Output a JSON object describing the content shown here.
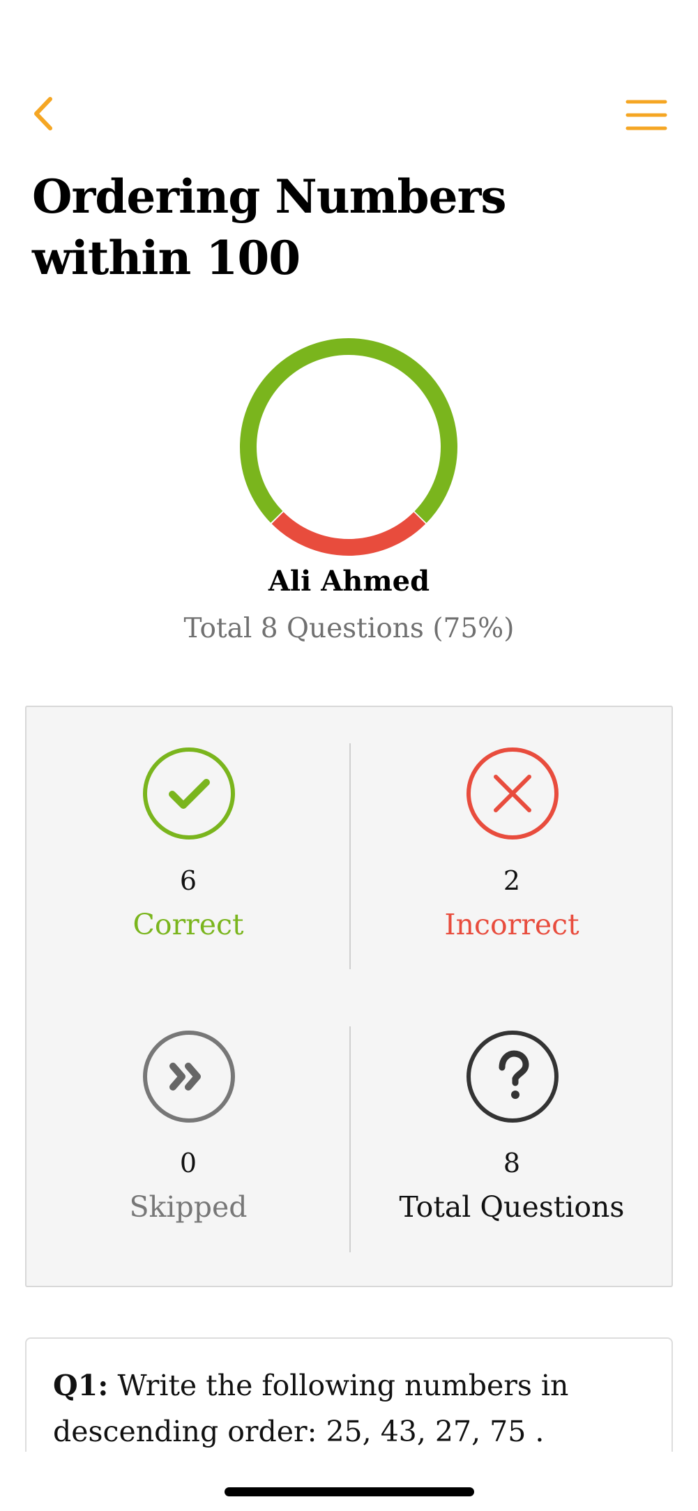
{
  "header": {
    "back_icon": "chevron-left-icon",
    "menu_icon": "hamburger-menu-icon",
    "accent_color": "#F5A623"
  },
  "title": "Ordering Numbers within 100",
  "result": {
    "student_name": "Ali Ahmed",
    "summary": "Total 8 Questions (75%)",
    "correct_fraction": 0.75,
    "incorrect_fraction": 0.25,
    "colors": {
      "correct": "#7AB51D",
      "incorrect": "#E84C3D",
      "skipped": "#777777",
      "total": "#333333"
    }
  },
  "stats": {
    "correct": {
      "value": "6",
      "label": "Correct",
      "icon": "check-circle-icon"
    },
    "incorrect": {
      "value": "2",
      "label": "Incorrect",
      "icon": "x-circle-icon"
    },
    "skipped": {
      "value": "0",
      "label": "Skipped",
      "icon": "skip-forward-circle-icon"
    },
    "total": {
      "value": "8",
      "label": "Total Questions",
      "icon": "question-circle-icon"
    }
  },
  "questions": [
    {
      "number": "Q1:",
      "text": "Write the following numbers in descending order: 25, 43, 27, 75 ."
    }
  ]
}
